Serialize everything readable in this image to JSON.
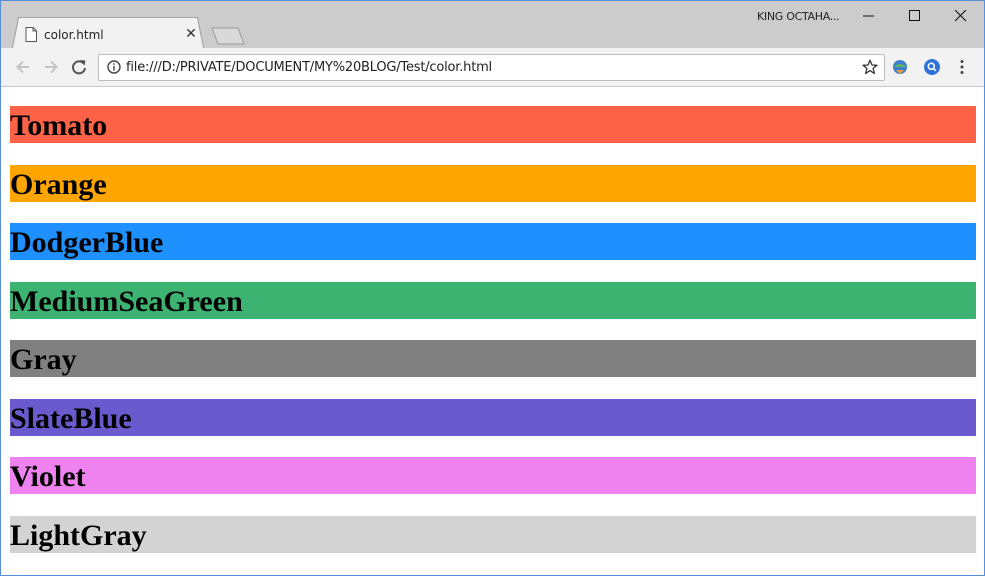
{
  "tab": {
    "title": "color.html",
    "close_glyph": "✕"
  },
  "profile": {
    "label": "KING OCTAHA..."
  },
  "window_controls": {
    "minimize": "minimize-icon",
    "maximize": "maximize-icon",
    "close": "close-icon"
  },
  "toolbar": {
    "back": "back-arrow-icon",
    "forward": "forward-arrow-icon",
    "reload": "reload-icon",
    "url": "file:///D:/PRIVATE/DOCUMENT/MY%20BLOG/Test/color.html",
    "extensions": [
      "idm-extension-icon",
      "search-extension-icon"
    ],
    "menu": "more-vert-icon"
  },
  "colors": {
    "tabstrip": "#cccccc",
    "toolbar": "#f2f2f2",
    "window_border": "#5a8fd8"
  },
  "color_bars": [
    {
      "label": "Tomato",
      "color": "#ff6347"
    },
    {
      "label": "Orange",
      "color": "#ffa500"
    },
    {
      "label": "DodgerBlue",
      "color": "#1e90ff"
    },
    {
      "label": "MediumSeaGreen",
      "color": "#3cb371"
    },
    {
      "label": "Gray",
      "color": "#808080"
    },
    {
      "label": "SlateBlue",
      "color": "#6a5acd"
    },
    {
      "label": "Violet",
      "color": "#ee82ee"
    },
    {
      "label": "LightGray",
      "color": "#d3d3d3"
    }
  ]
}
